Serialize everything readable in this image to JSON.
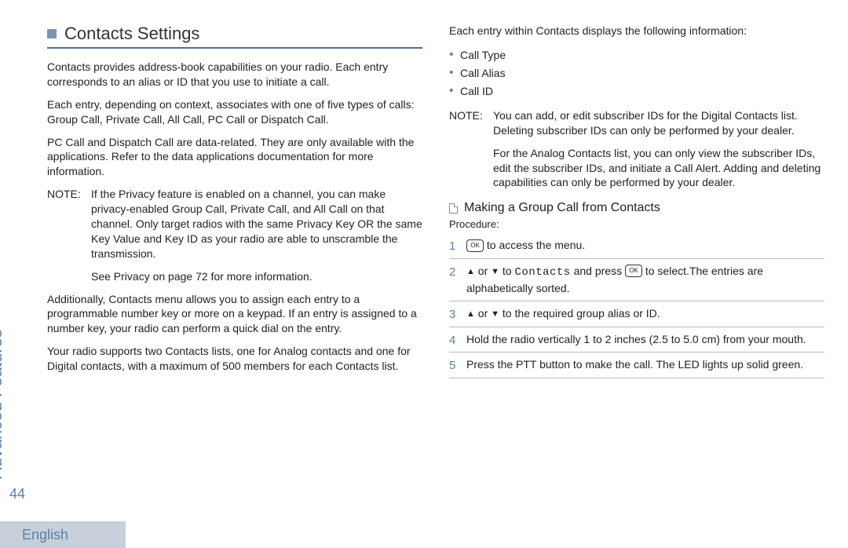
{
  "sidebar": {
    "section_label": "Advanced Features",
    "page_number": "44"
  },
  "left": {
    "heading": "Contacts Settings",
    "p1": "Contacts provides  address-book  capabilities on your radio. Each entry corresponds to an alias or ID that you use to initiate a call.",
    "p2": "Each entry, depending on context, associates with one of five types of calls: Group Call, Private Call, All Call, PC Call or Dispatch Call.",
    "p3": "PC Call and Dispatch Call are data-related. They are only available with the applications. Refer to the data applications documentation for more information.",
    "note_label": "NOTE:",
    "note_body": "If the Privacy feature is enabled on a channel, you can make privacy-enabled Group Call, Private Call, and All Call on that channel. Only target radios with the same Privacy Key OR the same Key Value and Key ID as your radio are able to unscramble the transmission.",
    "note_sub": "See Privacy  on page 72 for more information.",
    "p4": "Additionally, Contacts menu allows you to assign each entry to a programmable number key or more on a keypad. If an entry is assigned to a number key, your radio can perform a quick dial on the entry.",
    "p5": "Your radio supports two Contacts lists, one for Analog contacts and one for Digital contacts, with a maximum of 500 members for each Contacts list."
  },
  "right": {
    "intro": "Each entry within Contacts displays the following information:",
    "bullets": [
      "Call Type",
      "Call Alias",
      "Call ID"
    ],
    "note_label": "NOTE:",
    "note_body1": "You can add, or edit subscriber IDs for the Digital Contacts list. Deleting subscriber IDs can only be performed by your dealer.",
    "note_body2": "For the Analog Contacts list, you can only view the subscriber IDs, edit the subscriber IDs, and initiate a Call Alert. Adding and deleting capabilities can only be performed by your dealer.",
    "subhead": "Making a Group Call from Contacts",
    "procedure_label": "Procedure:",
    "menu_ok": "OK",
    "steps": {
      "s1_tail": " to access the menu.",
      "s2a": " or ",
      "s2b": " to ",
      "s2_target": "Contacts",
      "s2c": " and press ",
      "s2_tail": " to select.The entries are alphabetically sorted.",
      "s3a": " or ",
      "s3_tail": " to the required group alias or ID.",
      "s4": "Hold the radio vertically 1 to 2 inches (2.5 to 5.0 cm) from your mouth.",
      "s5": "Press the PTT button to make the call. The LED lights up solid green."
    }
  },
  "footer": {
    "language": "English"
  }
}
